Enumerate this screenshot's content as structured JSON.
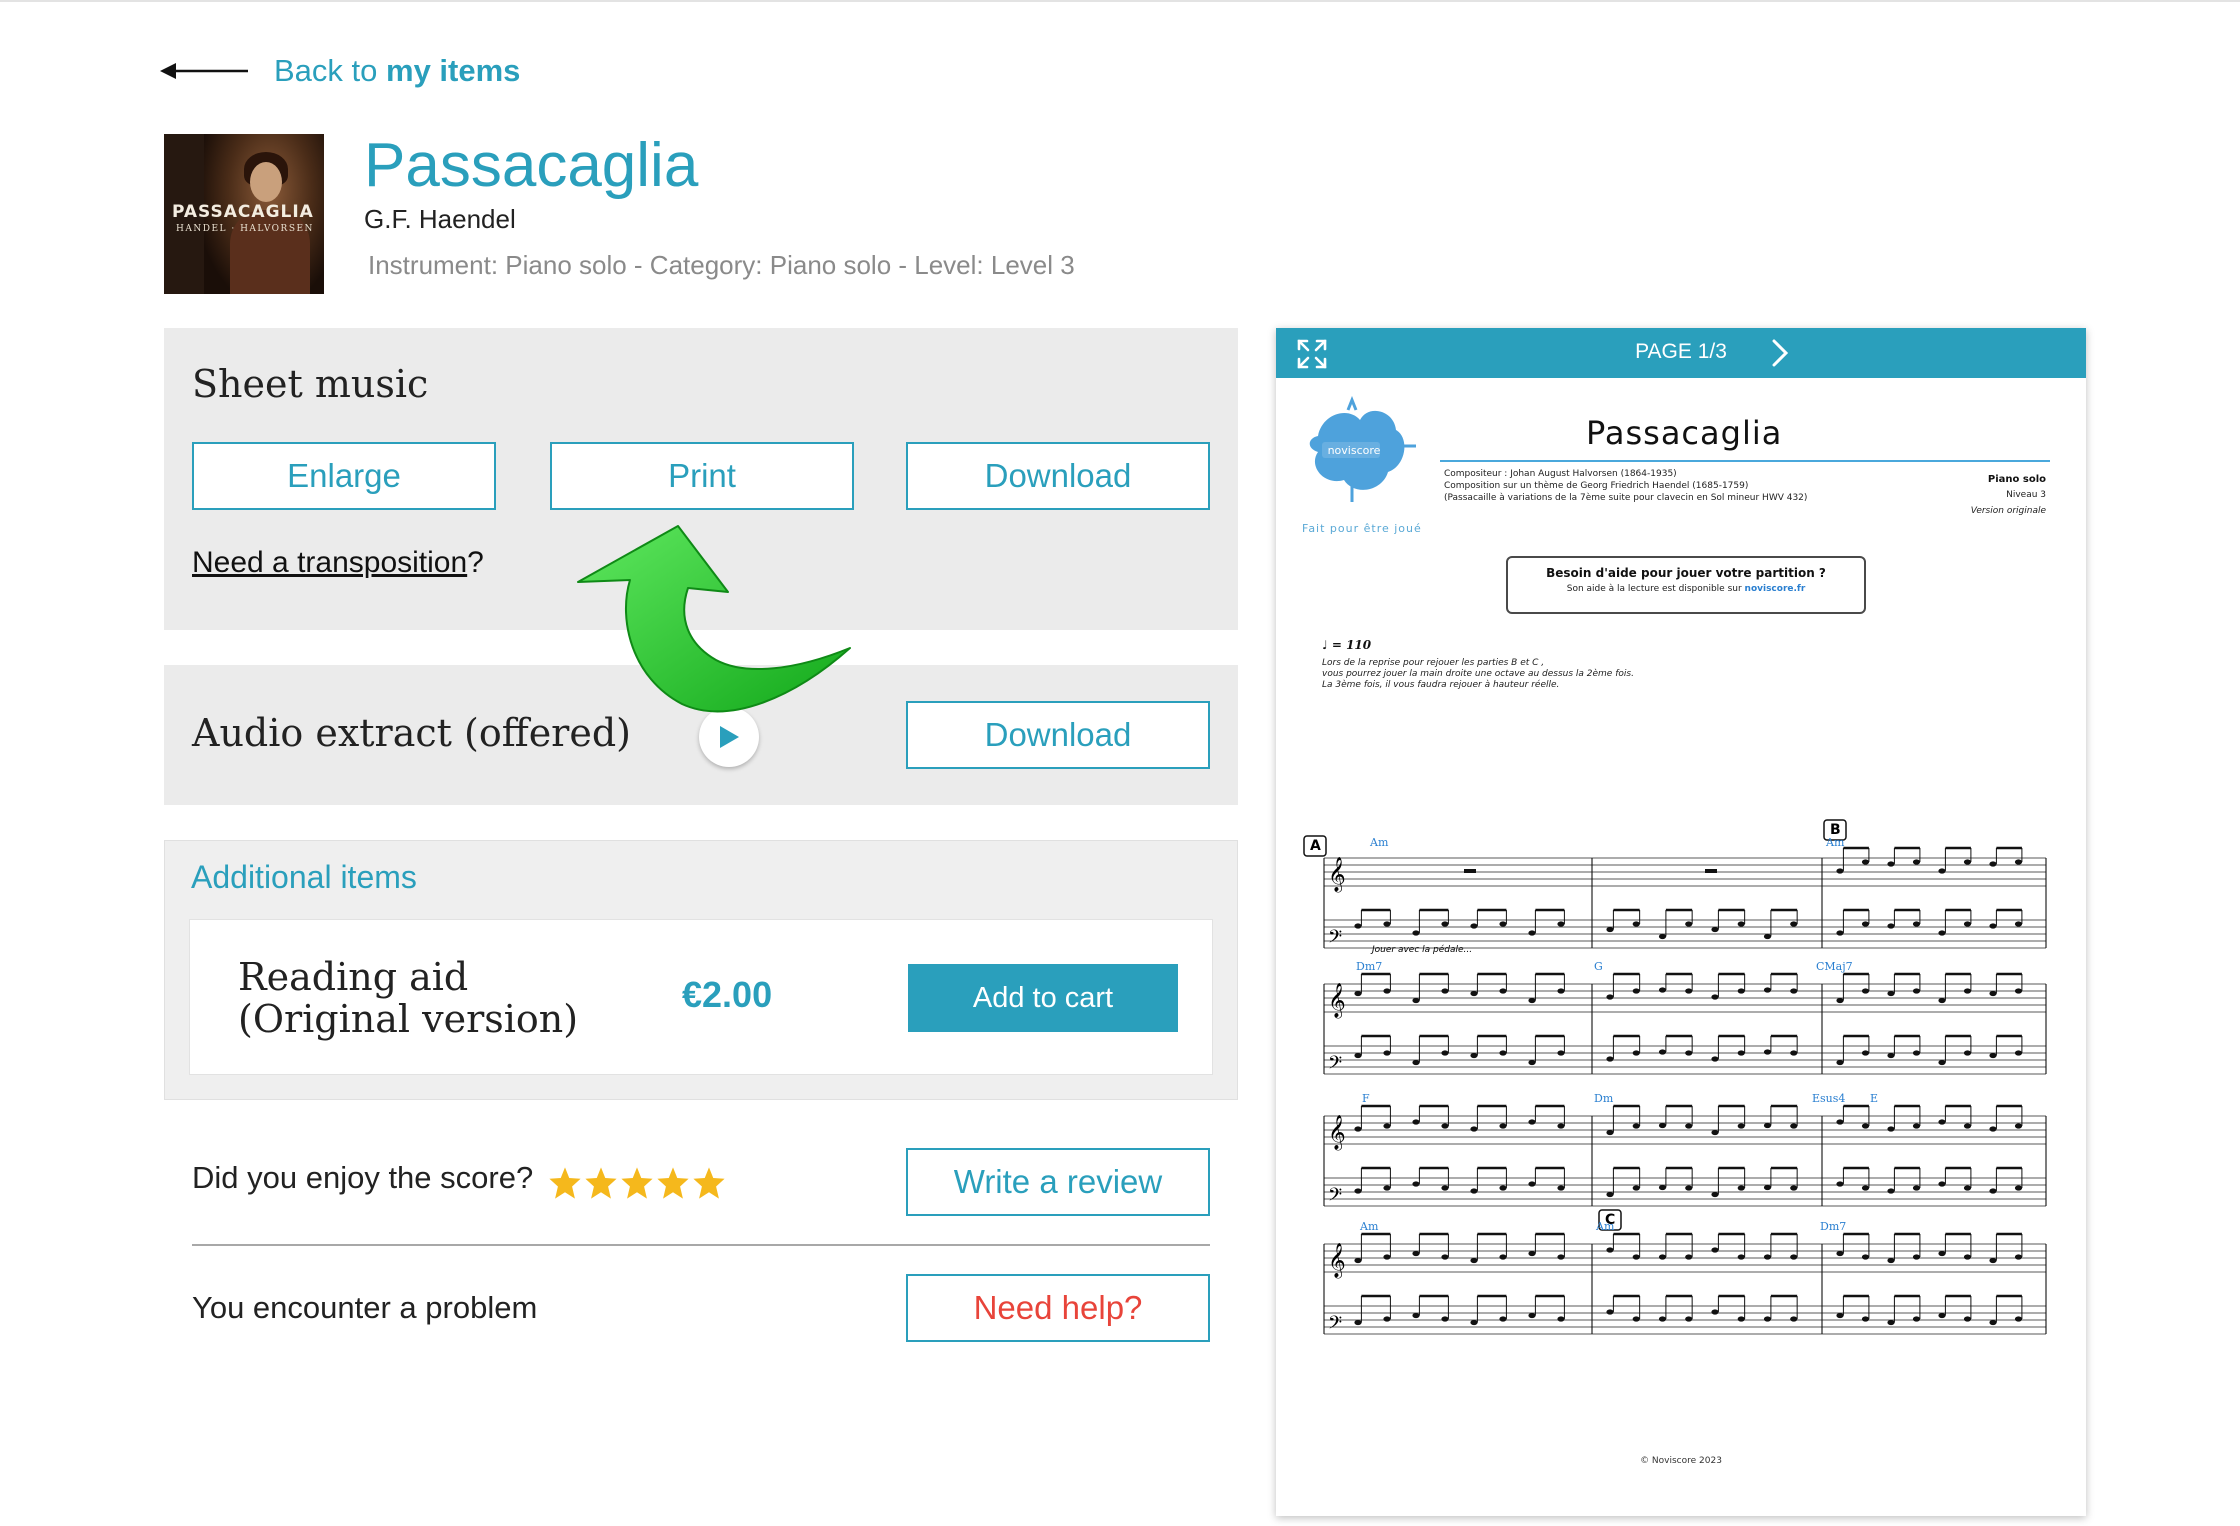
{
  "nav": {
    "back_prefix": "Back to ",
    "back_link": "my items"
  },
  "product": {
    "title": "Passacaglia",
    "composer": "G.F. Haendel",
    "meta": "Instrument: Piano solo - Category: Piano solo - Level: Level 3",
    "cover_title": "PASSACAGLIA",
    "cover_subtitle": "HANDEL · HALVORSEN"
  },
  "sheet_music": {
    "heading": "Sheet music",
    "enlarge_label": "Enlarge",
    "print_label": "Print",
    "download_label": "Download",
    "transposition_link": "Need a transposition",
    "transposition_suffix": "?"
  },
  "audio": {
    "heading": "Audio extract (offered)",
    "download_label": "Download"
  },
  "additional": {
    "heading": "Additional items",
    "item_name": "Reading aid (Original version)",
    "item_price": "€2.00",
    "add_to_cart_label": "Add to cart"
  },
  "feedback": {
    "enjoy_text": "Did you enjoy the score?",
    "rating": 5,
    "review_label": "Write a review",
    "problem_text": "You encounter a problem",
    "help_label": "Need help?"
  },
  "viewer": {
    "page_indicator": "PAGE 1/3",
    "score_title": "Passacaglia",
    "logo_text": "noviscore",
    "tagline": "Fait pour être joué",
    "credit_lines": [
      "Compositeur : Johan August Halvorsen (1864-1935)",
      "Composition sur un thème de Georg Friedrich Haendel (1685-1759)",
      "(Passacaille à variations de la 7ème suite pour clavecin en Sol mineur HWV 432)"
    ],
    "instrument": "Piano solo",
    "level": "Niveau 3",
    "version": "Version originale",
    "help_title": "Besoin d'aide pour jouer votre partition ?",
    "help_text": "Son aide à la lecture est disponible sur ",
    "help_site": "noviscore.fr",
    "tempo": "♩ = 110",
    "instructions": [
      "Lors de la reprise pour rejouer les parties B et C ,",
      "vous pourrez jouer la main droite une octave au dessus la 2ème fois.",
      "La 3ème fois, il vous faudra rejouer à hauteur réelle."
    ],
    "pedal_note": "Jouer avec la pédale...",
    "rehearsal_marks": [
      "A",
      "B",
      "C"
    ],
    "chords": [
      "Am",
      "Am",
      "Dm7",
      "G",
      "CMaj7",
      "F",
      "Dm",
      "Esus4",
      "E",
      "Am",
      "Am",
      "Dm7"
    ],
    "copyright": "© Noviscore 2023"
  },
  "colors": {
    "accent": "#2a9fbc",
    "panel": "#ebebeb",
    "help_red": "#e8443a",
    "star": "#f5b81c",
    "arrow_green": "#22c22a"
  },
  "icons": [
    "back-arrow-icon",
    "play-icon",
    "star-icon",
    "expand-icon",
    "chevron-right-icon",
    "curved-arrow-icon",
    "noviscore-logo-icon"
  ]
}
